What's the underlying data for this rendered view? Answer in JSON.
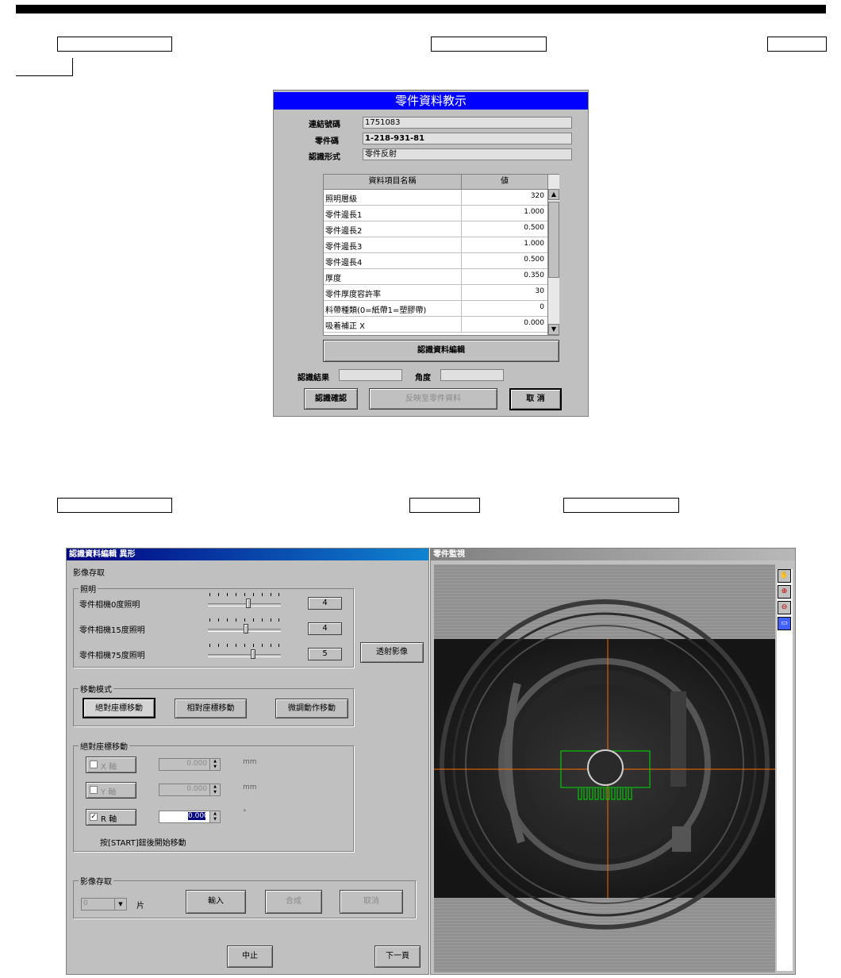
{
  "dialog1": {
    "title": "零件資料教示",
    "fields": [
      {
        "label": "連結號碼",
        "value": "1751083"
      },
      {
        "label": "零件碼",
        "value": "1-218-931-81"
      },
      {
        "label": "認識形式",
        "value": "零件反射"
      }
    ],
    "table": {
      "headers": [
        "資料項目名稱",
        "値"
      ],
      "rows": [
        {
          "name": "照明層級",
          "value": "320"
        },
        {
          "name": "零件邊長1",
          "value": "1.000"
        },
        {
          "name": "零件邊長2",
          "value": "0.500"
        },
        {
          "name": "零件邊長3",
          "value": "1.000"
        },
        {
          "name": "零件邊長4",
          "value": "0.500"
        },
        {
          "name": "厚度",
          "value": "0.350"
        },
        {
          "name": "零件厚度容許率",
          "value": "30"
        },
        {
          "name": "料帶種類(0=紙帶1=塑膠帶)",
          "value": "0"
        },
        {
          "name": "吸着補正 X",
          "value": "0.000"
        }
      ]
    },
    "edit_button": "認識資料編輯",
    "result_label": "認識結果",
    "result_value": "",
    "angle_label": "角度",
    "angle_value": "",
    "confirm_button": "認識確認",
    "apply_button": "反映至零件資料",
    "cancel_button": "取  消"
  },
  "dialog2": {
    "title": "認識資料編輯  異形",
    "section_title": "影像存取",
    "lighting": {
      "label": "照明",
      "rows": [
        {
          "label": "零件相機0度照明",
          "value": "4",
          "level": 0.55
        },
        {
          "label": "零件相機15度照明",
          "value": "4",
          "level": 0.52
        },
        {
          "label": "零件相機75度照明",
          "value": "5",
          "level": 0.62
        }
      ]
    },
    "transmit_button": "透射影像",
    "move_mode": {
      "label": "移動模式",
      "buttons": [
        "絕對座標移動",
        "相對座標移動",
        "微調動作移動"
      ]
    },
    "abs_move": {
      "label": "絕對座標移動",
      "axes": [
        {
          "label": "X 軸",
          "checked": false,
          "value": "0.000",
          "unit": "mm"
        },
        {
          "label": "Y 軸",
          "checked": false,
          "value": "0.000",
          "unit": "mm"
        },
        {
          "label": "R 軸",
          "checked": true,
          "value": "0.000",
          "unit": "°"
        }
      ],
      "hint": "按[START]鈕後開始移動"
    },
    "capture": {
      "label": "影像存取",
      "count": "0",
      "count_unit": "片",
      "buttons": [
        "輸入",
        "合成",
        "取消"
      ]
    },
    "stop_button": "中止",
    "next_button": "下一頁"
  },
  "monitor": {
    "title": "零件監視",
    "tools": [
      "hand-icon",
      "zoom-in-icon",
      "zoom-out-icon",
      "fit-icon"
    ]
  },
  "colors": {
    "title_blue": "#0000ff",
    "crosshair": "#ff6a00",
    "overlay_green": "#00e000"
  }
}
